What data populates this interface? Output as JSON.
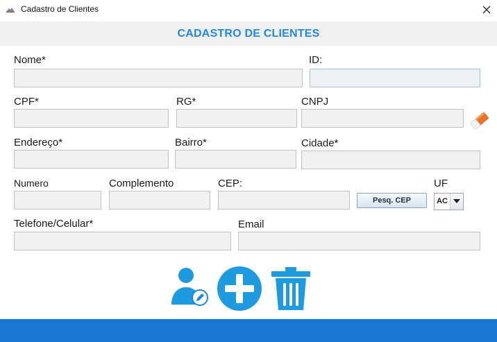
{
  "window": {
    "title": "Cadastro de Clientes"
  },
  "header": {
    "title": "CADASTRO DE CLIENTES"
  },
  "form": {
    "nome": {
      "label": "Nome*",
      "value": ""
    },
    "id": {
      "label": "ID:",
      "value": ""
    },
    "cpf": {
      "label": "CPF*",
      "value": ""
    },
    "rg": {
      "label": "RG*",
      "value": ""
    },
    "cnpj": {
      "label": "CNPJ",
      "value": ""
    },
    "endereco": {
      "label": "Endereço*",
      "value": ""
    },
    "bairro": {
      "label": "Bairro*",
      "value": ""
    },
    "cidade": {
      "label": "Cidade*",
      "value": ""
    },
    "numero": {
      "label": "Numero",
      "value": ""
    },
    "complemento": {
      "label": "Complemento",
      "value": ""
    },
    "cep": {
      "label": "CEP:",
      "value": ""
    },
    "pesq_cep_label": "Pesq. CEP",
    "uf": {
      "label": "UF",
      "selected": "AC"
    },
    "telefone": {
      "label": "Telefone/Celular*",
      "value": ""
    },
    "email": {
      "label": "Email",
      "value": ""
    }
  },
  "icons": {
    "app": "app-logo-icon",
    "close": "close-icon",
    "clear_cnpj": "eraser-icon",
    "edit_client": "edit-user-icon",
    "add_client": "add-icon",
    "delete_client": "trash-icon"
  },
  "colors": {
    "accent": "#1e88e5",
    "header_band": "#f0f0f0",
    "footer_bar": "#1976d2",
    "field_bg": "#f0f0f0"
  }
}
